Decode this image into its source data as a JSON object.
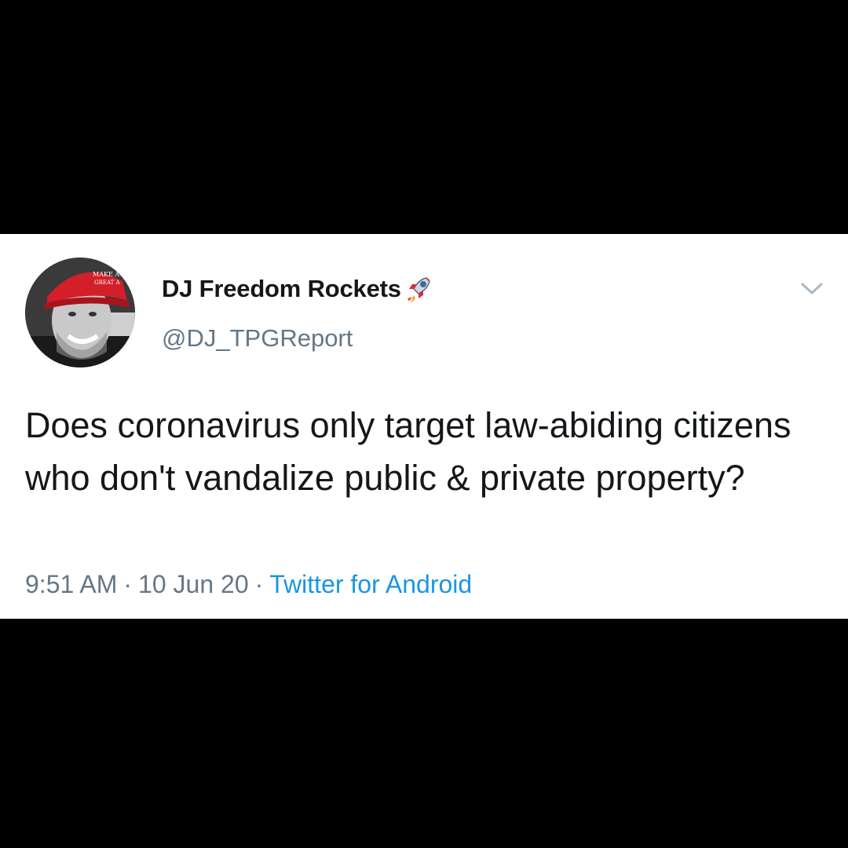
{
  "tweet": {
    "author": {
      "display_name": "DJ Freedom Rockets",
      "name_emoji": "rocket-icon",
      "handle": "@DJ_TPGReport",
      "avatar": "profile-photo-red-cap",
      "avatar_cap_text": [
        "MAKE A",
        "GREAT A"
      ]
    },
    "text": "Does coronavirus only target law-abiding citizens who don't vandalize public & private property?",
    "time": "9:51 AM",
    "date": "10 Jun 20",
    "separator": "·",
    "source": "Twitter for Android",
    "menu_icon": "chevron-down-icon"
  },
  "colors": {
    "background": "#000000",
    "card": "#ffffff",
    "text_primary": "#14171a",
    "text_secondary": "#657786",
    "link": "#1b95e0",
    "chevron": "#aab8c2",
    "cap_red": "#d31f2a"
  }
}
